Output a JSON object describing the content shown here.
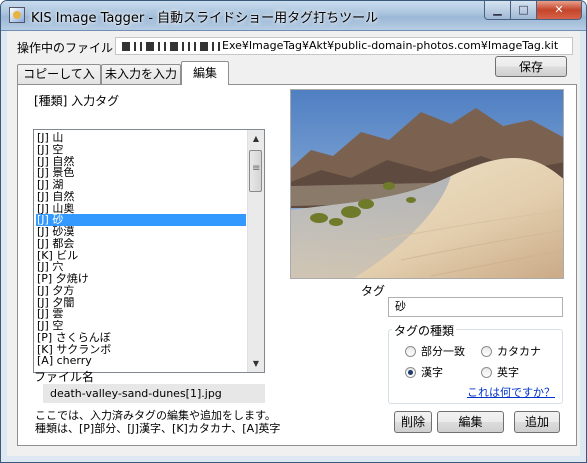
{
  "window": {
    "title": "KIS Image Tagger  - 自動スライドショー用タグ打ちツール",
    "minimize_glyph": "▁",
    "maximize_glyph": "□",
    "close_glyph": "✕"
  },
  "header": {
    "file_label": "操作中のファイル",
    "path_suffix": "Exe¥ImageTag¥Akt¥public-domain-photos.com¥ImageTag.kit",
    "save_label": "保存"
  },
  "tabs": [
    {
      "label": "コピーして入力"
    },
    {
      "label": "未入力を入力"
    },
    {
      "label": "編集"
    }
  ],
  "tag_list": {
    "heading": "[種類] 入力タグ",
    "items": [
      "[J] 山",
      "[J] 空",
      "[J] 自然",
      "[J] 景色",
      "[J] 湖",
      "[J] 自然",
      "[J] 山奥",
      "[J] 砂",
      "[J] 砂漠",
      "[J] 都会",
      "[K] ビル",
      "[J] 穴",
      "[P] 夕焼け",
      "[J] 夕方",
      "[J] 夕闇",
      "[J] 雲",
      "[J] 空",
      "[P] さくらんぼ",
      "[K] サクランボ",
      "[A] cherry"
    ],
    "selected_index": 7
  },
  "file": {
    "label": "ファイル名",
    "name": "death-valley-sand-dunes[1].jpg"
  },
  "help_text": {
    "line1": "ここでは、入力済みタグの編集や追加をします。",
    "line2": "種類は、[P]部分、[J]漢字、[K]カタカナ、[A]英字"
  },
  "tag_editor": {
    "label": "タグ",
    "value": "砂"
  },
  "tag_type": {
    "legend": "タグの種類",
    "options": [
      {
        "label": "部分一致",
        "checked": false
      },
      {
        "label": "カタカナ",
        "checked": false
      },
      {
        "label": "漢字",
        "checked": true
      },
      {
        "label": "英字",
        "checked": false
      }
    ],
    "help_link": "これは何ですか？"
  },
  "actions": {
    "delete_label": "削除",
    "edit_label": "編集",
    "add_label": "追加"
  },
  "colors": {
    "selection": "#3399ff",
    "link": "#0033cc"
  }
}
